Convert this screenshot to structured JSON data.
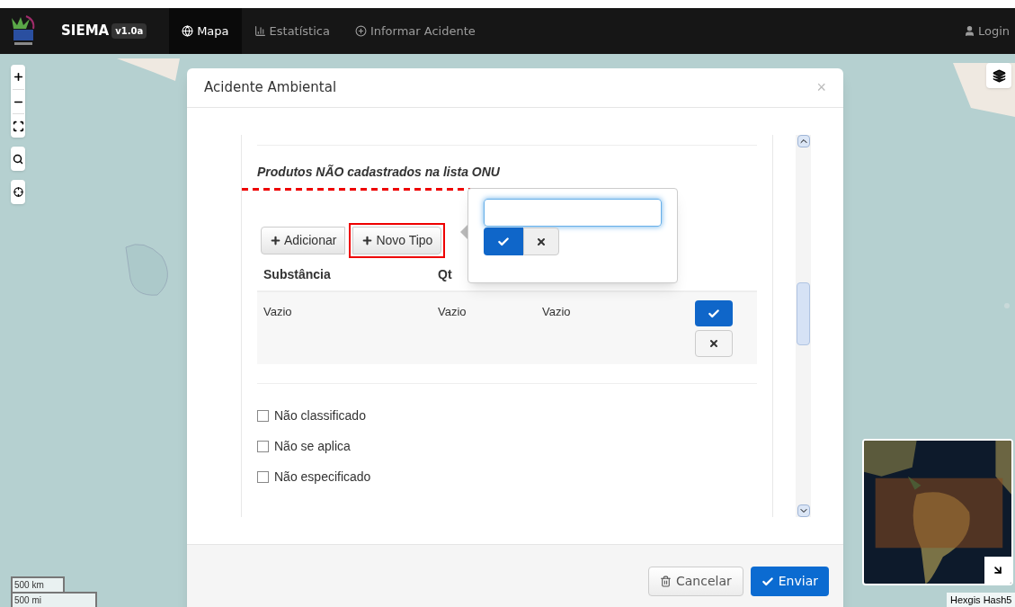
{
  "navbar": {
    "brand": "SIEMA",
    "version": "v1.0a",
    "items": [
      {
        "label": "Mapa",
        "kind": "globe",
        "selected": true
      },
      {
        "label": "Estatística",
        "kind": "chart",
        "selected": false
      },
      {
        "label": "Informar Acidente",
        "kind": "plus",
        "selected": false
      }
    ],
    "login": "Login"
  },
  "map": {
    "scale": [
      "500 km",
      "500 mi"
    ],
    "attribution": "Hexgis Hash5"
  },
  "dialog": {
    "title": "Acidente Ambiental",
    "close": "×",
    "section_title": "Produtos NÃO cadastrados na lista ONU",
    "buttons": [
      {
        "label": "Adicionar",
        "highlighted": false
      },
      {
        "label": "Novo Tipo",
        "highlighted": true
      }
    ],
    "table": {
      "columns": [
        "Substância",
        "Qt"
      ],
      "rows": [
        {
          "cells": [
            "Vazio",
            "Vazio",
            "Vazio"
          ]
        }
      ]
    },
    "options": [
      {
        "label": "Não classificado",
        "checked": false
      },
      {
        "label": "Não se aplica",
        "checked": false
      },
      {
        "label": "Não especificado",
        "checked": false
      }
    ],
    "footer": [
      {
        "label": "Cancelar",
        "kind": "secondary"
      },
      {
        "label": "Enviar",
        "kind": "primary"
      }
    ]
  }
}
